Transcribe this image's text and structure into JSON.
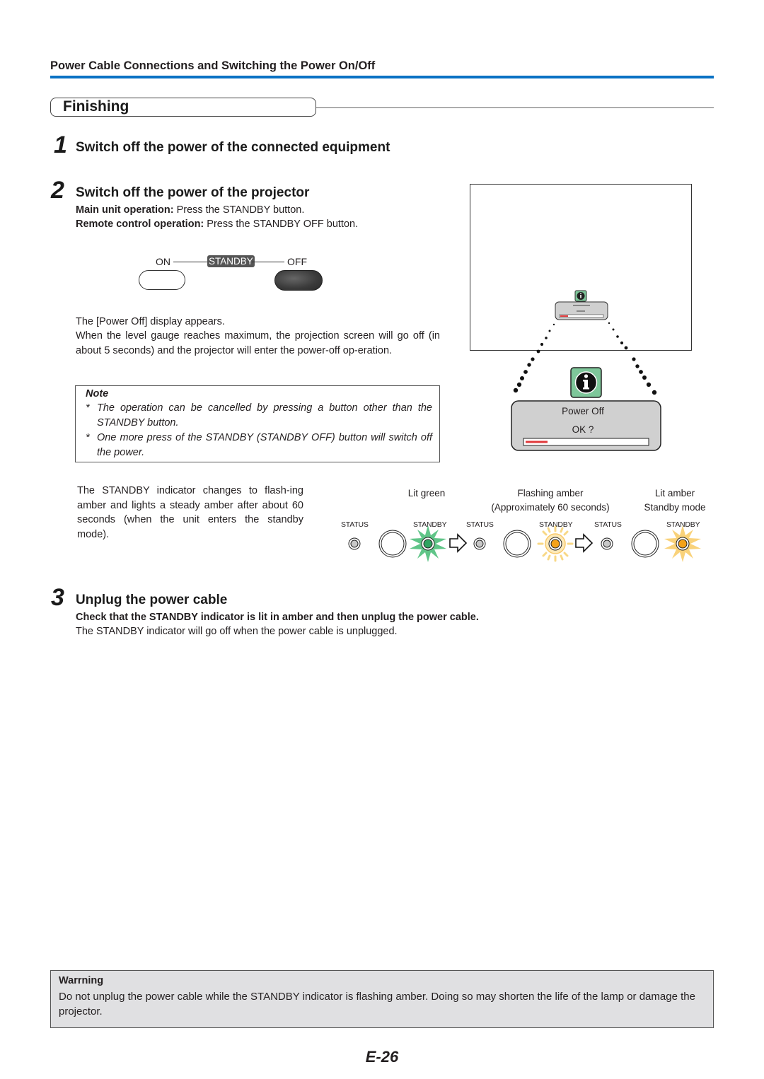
{
  "section_header": "Power Cable Connections and Switching the Power On/Off",
  "colors": {
    "accent_blue": "#0a72c4",
    "lit_green": "#2fa360",
    "amber": "#f4a21a",
    "warning_bg": "#e0e0e2"
  },
  "finishing": {
    "title": "Finishing"
  },
  "steps": [
    {
      "number": "1",
      "title": "Switch off the power of the connected equipment"
    },
    {
      "number": "2",
      "title": "Switch off the power of the projector",
      "main_unit_label": "Main unit operation:",
      "main_unit_text": " Press the STANDBY button.",
      "remote_label": "Remote control operation:",
      "remote_text": " Press the STANDBY OFF button.",
      "switch": {
        "on_label": "ON",
        "standby_label": "STANDBY",
        "off_label": "OFF"
      },
      "paragraph_1": "The [Power Off] display appears.",
      "paragraph_2": "When the level gauge reaches maximum, the projection screen will go off (in about 5 seconds) and the projector will enter the power-off op-eration.",
      "note": {
        "title": "Note",
        "items": [
          "The operation can be cancelled by pressing a button other than the STANDBY button.",
          "One more press of the STANDBY (STANDBY OFF) button will switch off the power."
        ]
      },
      "indicator_paragraph": "The STANDBY indicator changes to flash-ing amber and lights a steady amber after about 60 seconds (when the unit enters the standby mode).",
      "screen_dialog": {
        "icon": "info-icon",
        "title": "Power Off",
        "prompt": "OK ?",
        "gauge_progress": 0.18
      },
      "indicator_sequence": [
        {
          "caption_1": "Lit green",
          "caption_2": "",
          "status_label": "STATUS",
          "standby_label": "STANDBY",
          "state": "lit-green"
        },
        {
          "caption_1": "Flashing amber",
          "caption_2": "(Approximately 60 seconds)",
          "status_label": "STATUS",
          "standby_label": "STANDBY",
          "state": "flashing-amber"
        },
        {
          "caption_1": "Lit amber",
          "caption_2": "Standby mode",
          "status_label": "STATUS",
          "standby_label": "STANDBY",
          "state": "lit-amber"
        }
      ]
    },
    {
      "number": "3",
      "title": "Unplug the power cable",
      "bold_text": "Check that the STANDBY indicator is lit in amber and then unplug the power cable.",
      "text": "The STANDBY indicator will go off when the power cable is unplugged."
    }
  ],
  "warning": {
    "title": "Warrning",
    "text": "Do not unplug the power cable while the STANDBY indicator is flashing amber. Doing so may shorten the life of the lamp or damage the projector."
  },
  "page_number": "E-26"
}
